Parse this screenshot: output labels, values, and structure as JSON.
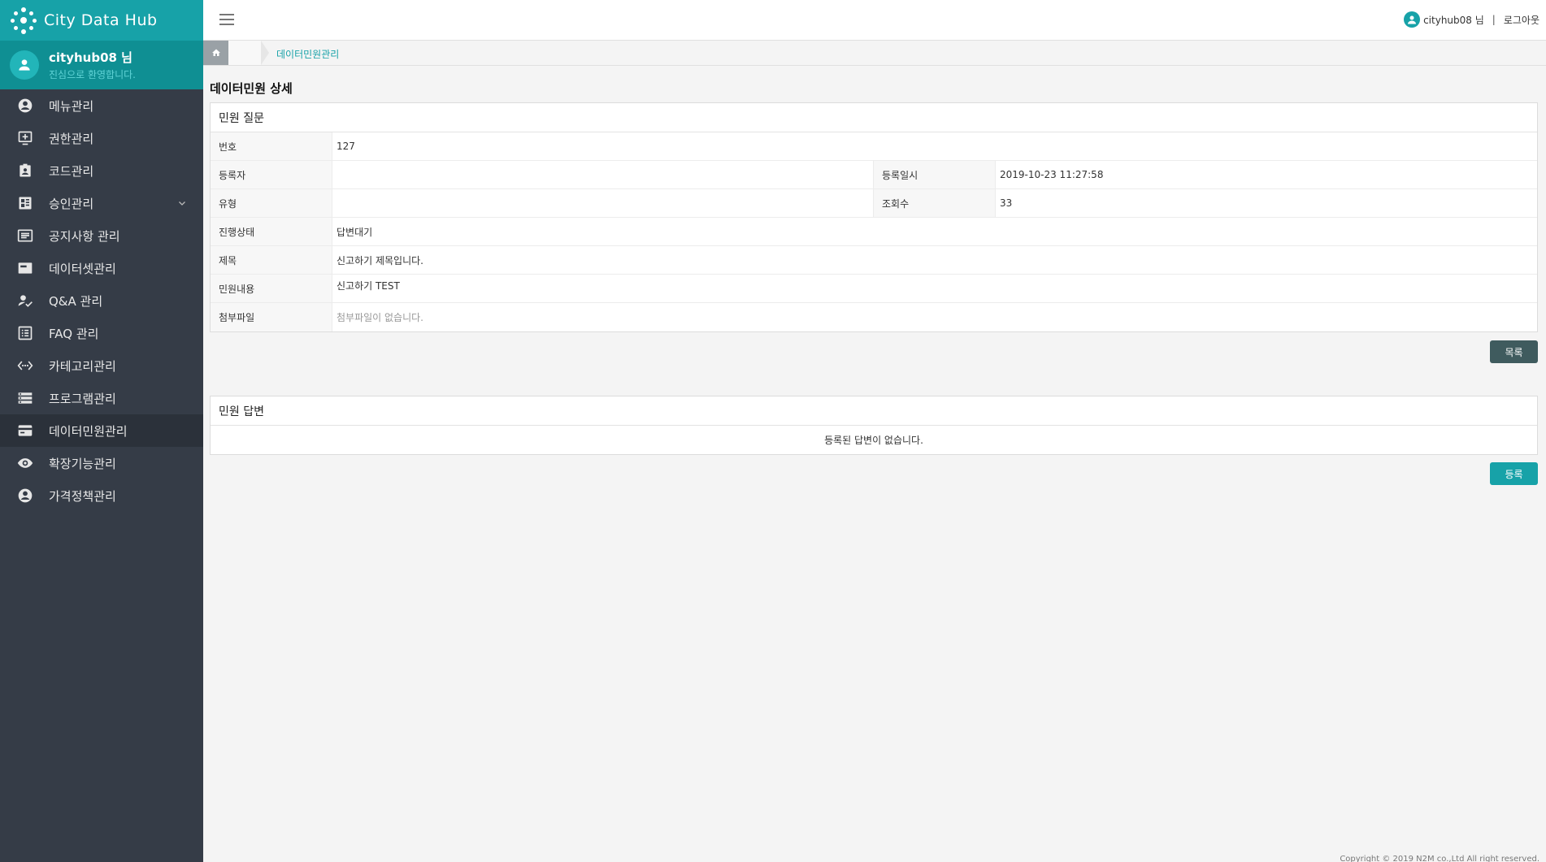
{
  "app": {
    "title": "City Data Hub"
  },
  "user": {
    "name": "cityhub08 님",
    "greeting": "진심으로 환영합니다."
  },
  "sidebar": {
    "items": [
      {
        "label": "메뉴관리",
        "icon": "account-circle-icon"
      },
      {
        "label": "권한관리",
        "icon": "add-box-icon"
      },
      {
        "label": "코드관리",
        "icon": "assignment-ind-icon"
      },
      {
        "label": "승인관리",
        "icon": "dashboard-icon",
        "has_children": true
      },
      {
        "label": "공지사항 관리",
        "icon": "notes-icon"
      },
      {
        "label": "데이터셋관리",
        "icon": "web-icon"
      },
      {
        "label": "Q&A 관리",
        "icon": "how-to-reg-icon"
      },
      {
        "label": "FAQ 관리",
        "icon": "list-alt-icon"
      },
      {
        "label": "카테고리관리",
        "icon": "settings-ethernet-icon"
      },
      {
        "label": "프로그램관리",
        "icon": "storage-icon"
      },
      {
        "label": "데이터민원관리",
        "icon": "credit-card-icon",
        "active": true
      },
      {
        "label": "확장기능관리",
        "icon": "eye-icon"
      },
      {
        "label": "가격정책관리",
        "icon": "account-circle-icon"
      }
    ]
  },
  "header": {
    "user_label": "cityhub08 님",
    "separator": "|",
    "logout": "로그아웃"
  },
  "breadcrumb": {
    "current": "데이터민원관리"
  },
  "page": {
    "title": "데이터민원 상세"
  },
  "question": {
    "heading": "민원 질문",
    "number_label": "번호",
    "number_value": "127",
    "author_label": "등록자",
    "author_value": "",
    "date_label": "등록일시",
    "date_value": "2019-10-23 11:27:58",
    "type_label": "유형",
    "type_value": "",
    "views_label": "조회수",
    "views_value": "33",
    "status_label": "진행상태",
    "status_value": "답변대기",
    "subject_label": "제목",
    "subject_value": "신고하기 제목입니다.",
    "content_label": "민원내용",
    "content_value": "신고하기 TEST",
    "attachment_label": "첨부파일",
    "attachment_value": "첨부파일이 없습니다."
  },
  "buttons": {
    "list": "목록",
    "register": "등록"
  },
  "answer": {
    "heading": "민원 답변",
    "empty": "등록된 답변이 없습니다."
  },
  "footer": {
    "copyright": "Copyright © 2019 N2M co.,Ltd All right reserved."
  },
  "colors": {
    "accent": "#17a2a8",
    "sidebar": "#353c47",
    "list_button": "#3f5b5e"
  }
}
